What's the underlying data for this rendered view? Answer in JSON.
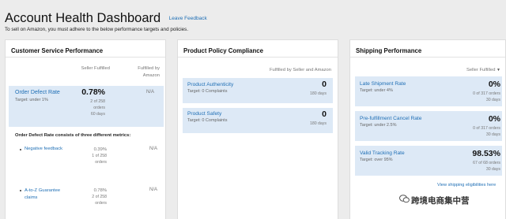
{
  "header": {
    "title": "Account Health Dashboard",
    "feedback_link": "Leave Feedback",
    "subtitle": "To sell on Amazon, you must adhere to the below performance targets and policies."
  },
  "customer_service": {
    "title": "Customer Service Performance",
    "col_seller": "Seller Fulfilled",
    "col_amazon_line1": "Fulfilled by",
    "col_amazon_line2": "Amazon",
    "odr": {
      "label": "Order Defect Rate",
      "target": "Target: under 1%",
      "value": "0.78%",
      "detail1": "2 of 258",
      "detail2": "orders",
      "detail3": "60 days",
      "amazon_value": "N/A"
    },
    "metrics_heading": "Order Defect Rate consists of three different metrics:",
    "metrics": [
      {
        "label": "Negative feedback",
        "value": "0.39%",
        "detail1": "1 of 258",
        "detail2": "orders",
        "amazon_value": "N/A"
      },
      {
        "label_line1": "A-to-Z Guarantee",
        "label_line2": "claims",
        "value": "0.78%",
        "detail1": "2 of 258",
        "detail2": "orders",
        "amazon_value": "N/A"
      }
    ]
  },
  "product_policy": {
    "title": "Product Policy Compliance",
    "col": "Fulfilled by Seller and Amazon",
    "items": [
      {
        "label": "Product Authenticity",
        "target": "Target: 0 Complaints",
        "value": "0",
        "period": "180 days"
      },
      {
        "label": "Product Safety",
        "target": "Target: 0 Complaints",
        "value": "0",
        "period": "180 days"
      }
    ]
  },
  "shipping": {
    "title": "Shipping Performance",
    "dropdown": "Seller Fulfilled",
    "items": [
      {
        "label": "Late Shipment Rate",
        "target": "Target: under 4%",
        "value": "0%",
        "detail1": "0 of 317 orders",
        "detail2": "30 days"
      },
      {
        "label": "Pre-fulfillment Cancel Rate",
        "target": "Target: under 2.5%",
        "value": "0%",
        "detail1": "0 of 317 orders",
        "detail2": "30 days"
      },
      {
        "label": "Valid Tracking Rate",
        "target": "Target: over 95%",
        "value": "98.53%",
        "detail1": "67 of 68 orders",
        "detail2": "30 days"
      }
    ],
    "eligibilities_link": "View shipping eligibilities here"
  },
  "watermark": {
    "text": "跨境电商集中营",
    "icon": "wechat-icon"
  }
}
